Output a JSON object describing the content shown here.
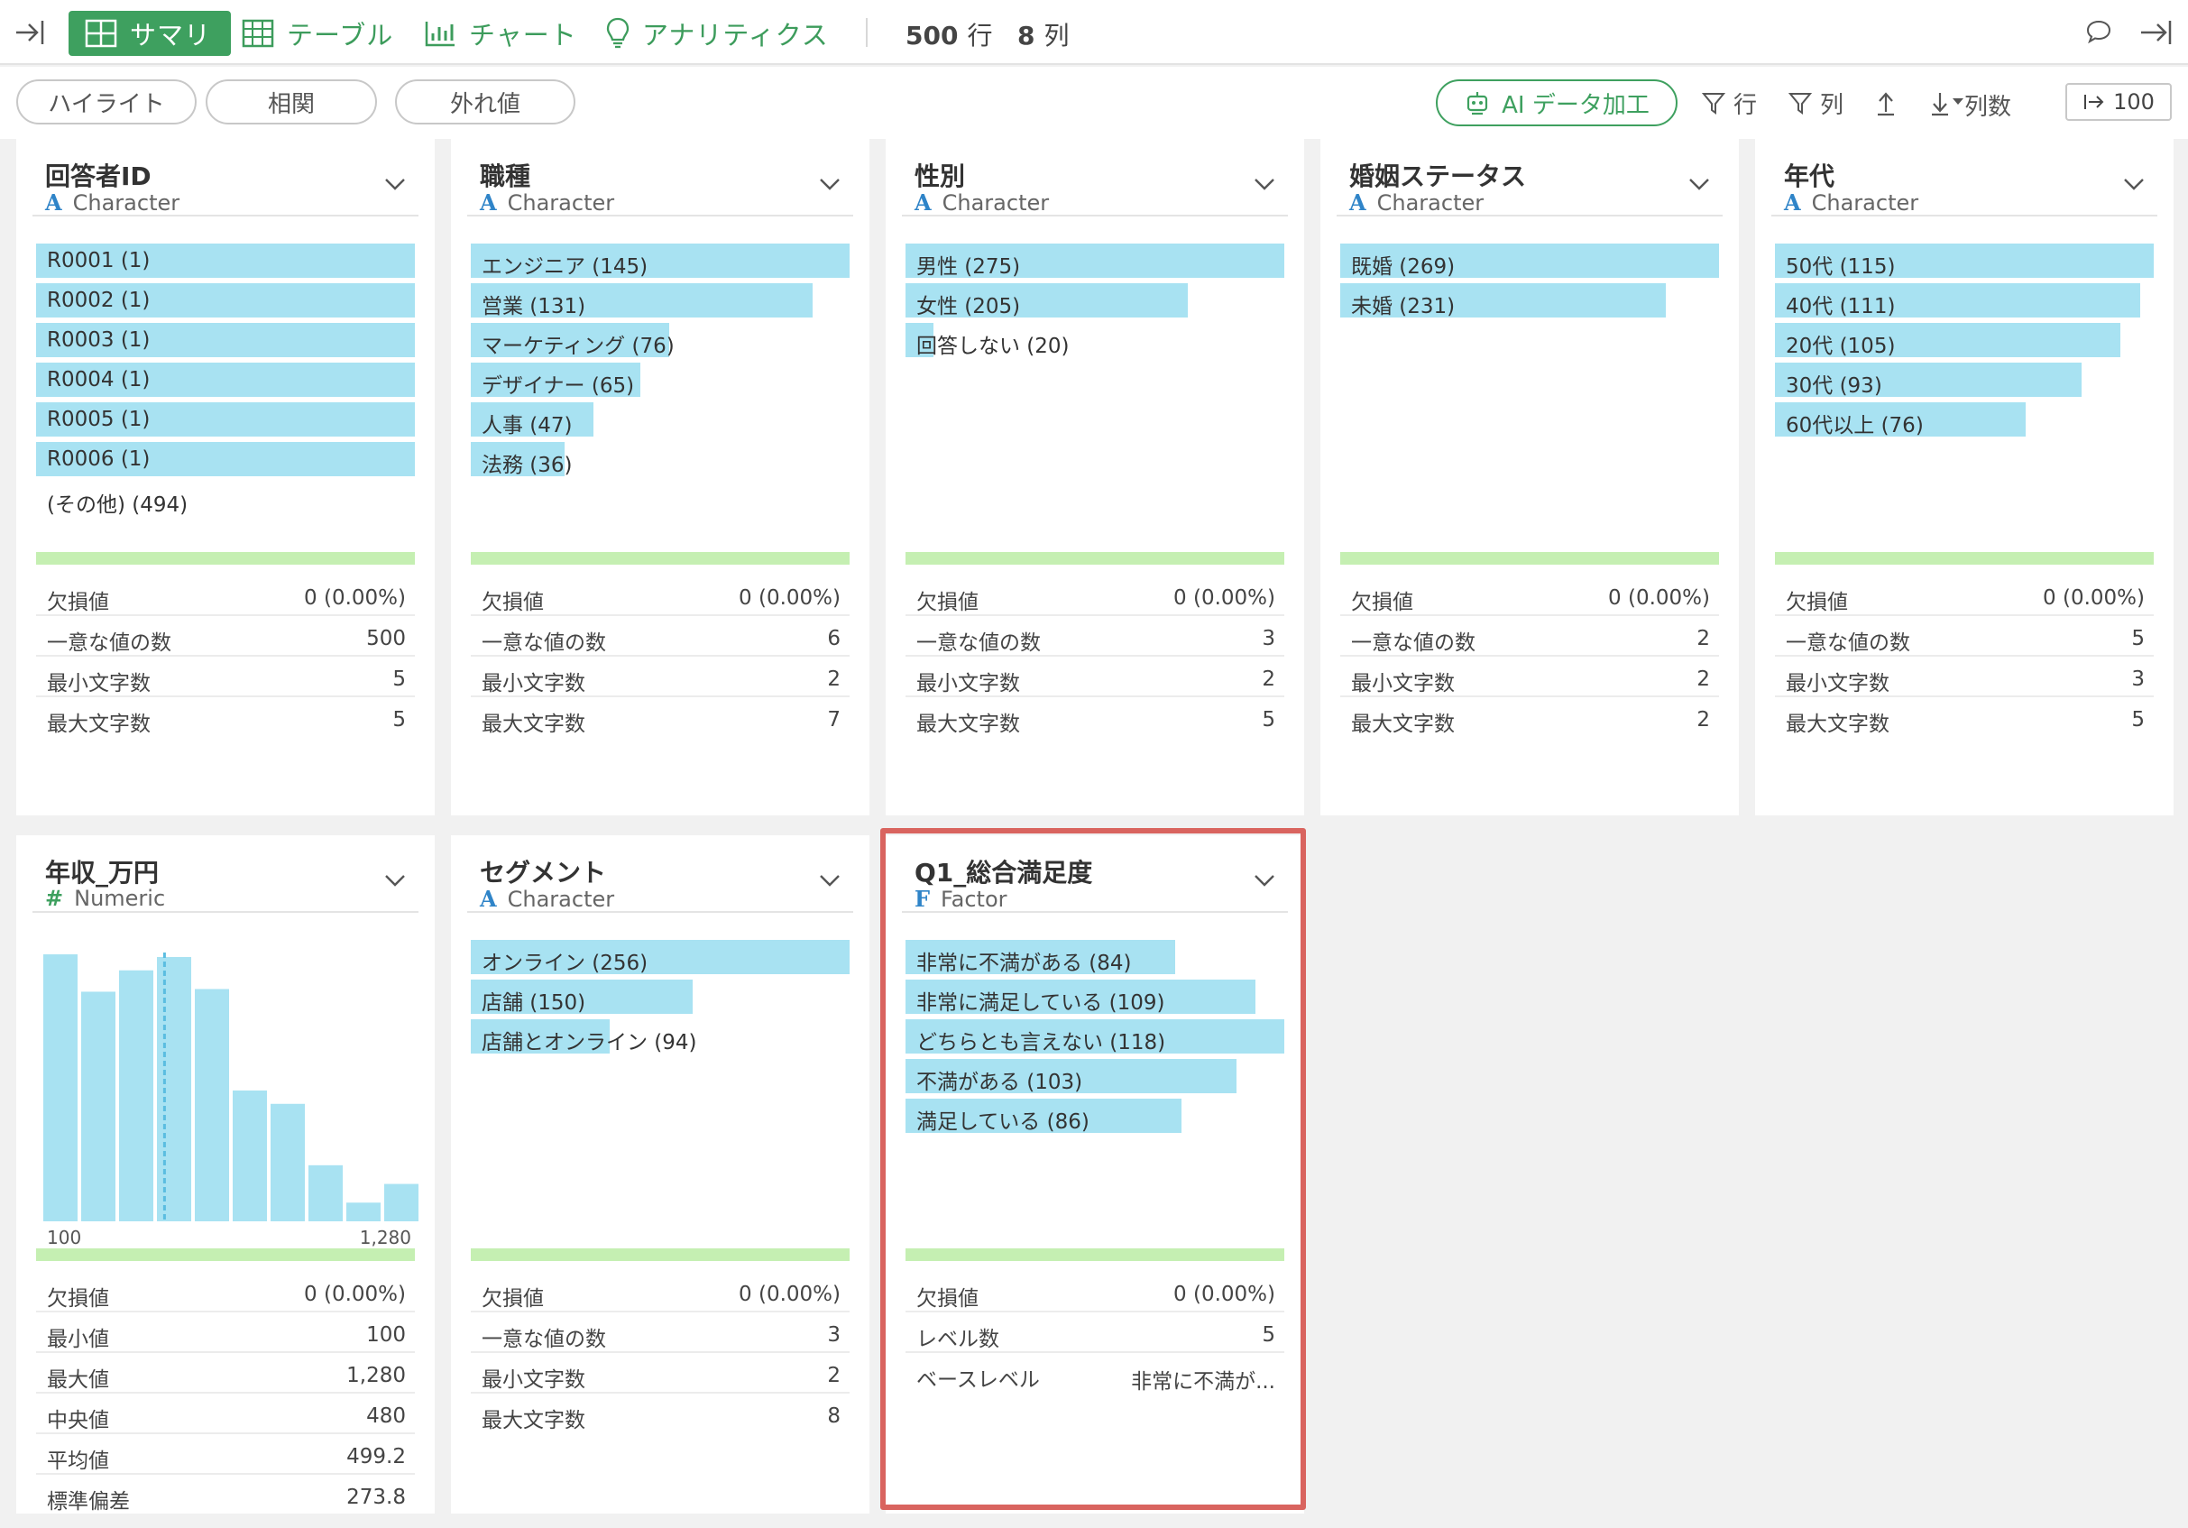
{
  "toolbar": {
    "tabs": [
      {
        "label": "サマリ",
        "icon": "summary-grid-icon",
        "active": true
      },
      {
        "label": "テーブル",
        "icon": "table-icon"
      },
      {
        "label": "チャート",
        "icon": "chart-icon"
      },
      {
        "label": "アナリティクス",
        "icon": "lightbulb-icon"
      }
    ],
    "rows": "500",
    "rows_unit": "行",
    "cols": "8",
    "cols_unit": "列"
  },
  "subbar": {
    "pills": [
      "ハイライト",
      "相関",
      "外れ値"
    ],
    "ai_label": "AI データ加工",
    "row_filter": "行",
    "col_filter": "列",
    "colcount_label": "列数",
    "colcount_value": "100"
  },
  "colors": {
    "accent": "#3ea05f",
    "bar": "#a8e2f2",
    "green_line": "#c5efb2",
    "highlight": "#d9645f"
  },
  "cards": [
    {
      "title": "回答者ID",
      "type_icon": "A",
      "type": "Character",
      "bars": [
        {
          "label": "R0001 (1)",
          "value": 1
        },
        {
          "label": "R0002 (1)",
          "value": 1
        },
        {
          "label": "R0003 (1)",
          "value": 1
        },
        {
          "label": "R0004 (1)",
          "value": 1
        },
        {
          "label": "R0005 (1)",
          "value": 1
        },
        {
          "label": "R0006 (1)",
          "value": 1
        },
        {
          "label": "(その他) (494)",
          "value": 0
        }
      ],
      "bar_max": 1,
      "stats": [
        {
          "k": "欠損値",
          "v": "0 (0.00%)"
        },
        {
          "k": "一意な値の数",
          "v": "500"
        },
        {
          "k": "最小文字数",
          "v": "5"
        },
        {
          "k": "最大文字数",
          "v": "5"
        }
      ]
    },
    {
      "title": "職種",
      "type_icon": "A",
      "type": "Character",
      "bars": [
        {
          "label": "エンジニア (145)",
          "value": 145
        },
        {
          "label": "営業 (131)",
          "value": 131
        },
        {
          "label": "マーケティング (76)",
          "value": 76
        },
        {
          "label": "デザイナー (65)",
          "value": 65
        },
        {
          "label": "人事 (47)",
          "value": 47
        },
        {
          "label": "法務 (36)",
          "value": 36
        }
      ],
      "bar_max": 145,
      "stats": [
        {
          "k": "欠損値",
          "v": "0 (0.00%)"
        },
        {
          "k": "一意な値の数",
          "v": "6"
        },
        {
          "k": "最小文字数",
          "v": "2"
        },
        {
          "k": "最大文字数",
          "v": "7"
        }
      ]
    },
    {
      "title": "性別",
      "type_icon": "A",
      "type": "Character",
      "bars": [
        {
          "label": "男性 (275)",
          "value": 275
        },
        {
          "label": "女性 (205)",
          "value": 205
        },
        {
          "label": "回答しない (20)",
          "value": 20
        }
      ],
      "bar_max": 275,
      "stats": [
        {
          "k": "欠損値",
          "v": "0 (0.00%)"
        },
        {
          "k": "一意な値の数",
          "v": "3"
        },
        {
          "k": "最小文字数",
          "v": "2"
        },
        {
          "k": "最大文字数",
          "v": "5"
        }
      ]
    },
    {
      "title": "婚姻ステータス",
      "type_icon": "A",
      "type": "Character",
      "bars": [
        {
          "label": "既婚 (269)",
          "value": 269
        },
        {
          "label": "未婚 (231)",
          "value": 231
        }
      ],
      "bar_max": 269,
      "stats": [
        {
          "k": "欠損値",
          "v": "0 (0.00%)"
        },
        {
          "k": "一意な値の数",
          "v": "2"
        },
        {
          "k": "最小文字数",
          "v": "2"
        },
        {
          "k": "最大文字数",
          "v": "2"
        }
      ]
    },
    {
      "title": "年代",
      "type_icon": "A",
      "type": "Character",
      "bars": [
        {
          "label": "50代 (115)",
          "value": 115
        },
        {
          "label": "40代 (111)",
          "value": 111
        },
        {
          "label": "20代 (105)",
          "value": 105
        },
        {
          "label": "30代 (93)",
          "value": 93
        },
        {
          "label": "60代以上 (76)",
          "value": 76
        }
      ],
      "bar_max": 115,
      "stats": [
        {
          "k": "欠損値",
          "v": "0 (0.00%)"
        },
        {
          "k": "一意な値の数",
          "v": "5"
        },
        {
          "k": "最小文字数",
          "v": "3"
        },
        {
          "k": "最大文字数",
          "v": "5"
        }
      ]
    },
    {
      "title": "年収_万円",
      "type_icon": "#",
      "type": "Numeric",
      "histogram": {
        "relative_heights": [
          1.0,
          0.86,
          0.94,
          0.99,
          0.87,
          0.49,
          0.44,
          0.21,
          0.07,
          0.14
        ],
        "median_line_position": 0.32,
        "min_label": "100",
        "max_label": "1,280"
      },
      "stats": [
        {
          "k": "欠損値",
          "v": "0 (0.00%)"
        },
        {
          "k": "最小値",
          "v": "100"
        },
        {
          "k": "最大値",
          "v": "1,280"
        },
        {
          "k": "中央値",
          "v": "480"
        },
        {
          "k": "平均値",
          "v": "499.2"
        },
        {
          "k": "標準偏差",
          "v": "273.8"
        }
      ]
    },
    {
      "title": "セグメント",
      "type_icon": "A",
      "type": "Character",
      "bars": [
        {
          "label": "オンライン (256)",
          "value": 256
        },
        {
          "label": "店舗 (150)",
          "value": 150
        },
        {
          "label": "店舗とオンライン (94)",
          "value": 94
        }
      ],
      "bar_max": 256,
      "stats": [
        {
          "k": "欠損値",
          "v": "0 (0.00%)"
        },
        {
          "k": "一意な値の数",
          "v": "3"
        },
        {
          "k": "最小文字数",
          "v": "2"
        },
        {
          "k": "最大文字数",
          "v": "8"
        }
      ]
    },
    {
      "title": "Q1_総合満足度",
      "type_icon": "F",
      "type": "Factor",
      "bars": [
        {
          "label": "非常に不満がある (84)",
          "value": 84
        },
        {
          "label": "非常に満足している (109)",
          "value": 109
        },
        {
          "label": "どちらとも言えない (118)",
          "value": 118
        },
        {
          "label": "不満がある (103)",
          "value": 103
        },
        {
          "label": "満足している (86)",
          "value": 86
        }
      ],
      "bar_max": 118,
      "stats": [
        {
          "k": "欠損値",
          "v": "0 (0.00%)"
        },
        {
          "k": "レベル数",
          "v": "5"
        },
        {
          "k": "ベースレベル",
          "v": "非常に不満が..."
        }
      ]
    }
  ]
}
